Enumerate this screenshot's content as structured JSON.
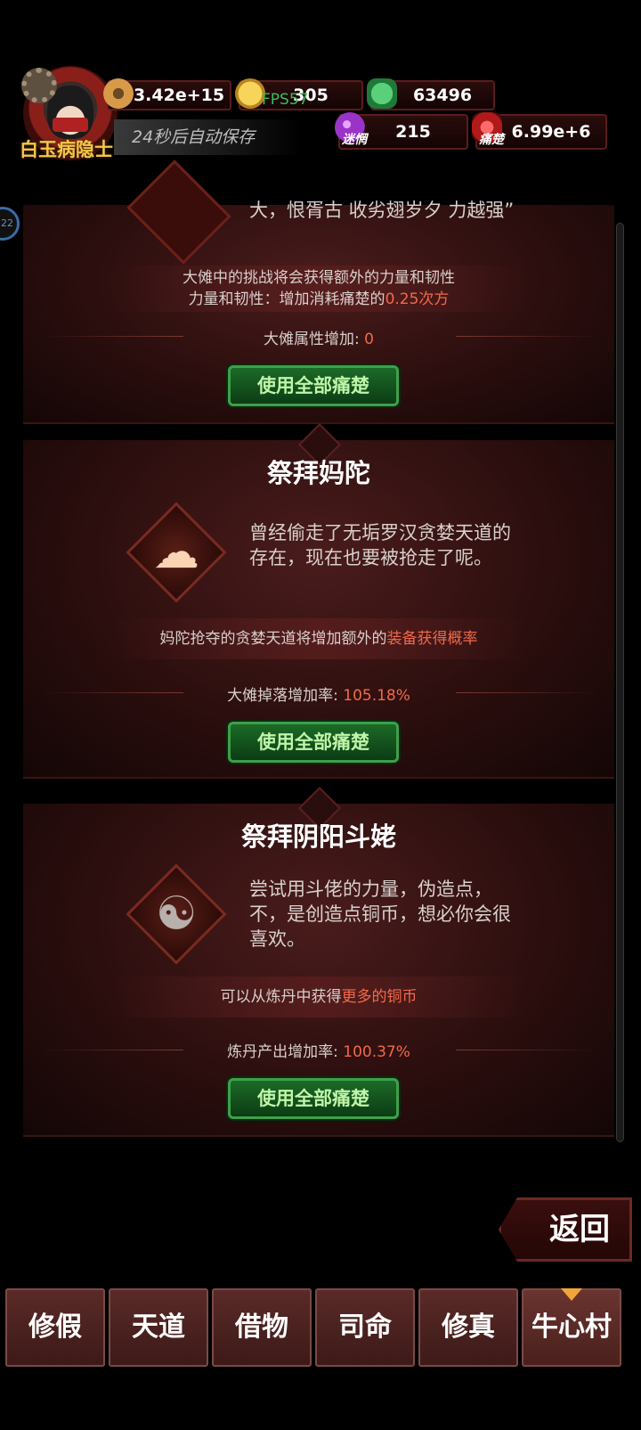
{
  "header": {
    "player_name": "白玉病隐士",
    "autosave_text": "24秒后自动保存",
    "fps": "FPS57",
    "resources": {
      "copper": "3.42e+15",
      "gold": "305",
      "jade": "63496",
      "confusion": "215",
      "confusion_label": "迷惘",
      "pain": "6.99e+6",
      "pain_label": "痛楚"
    },
    "side_badge": "22"
  },
  "cards": [
    {
      "desc": "大，恨胥古 收劣翅岁夕 力越强”",
      "effect": "大傩中的挑战将会获得额外的力量和韧性",
      "effect2_prefix": "力量和韧性：增加消耗痛楚的",
      "effect2_highlight": "0.25次方",
      "stat_label": "大傩属性增加: ",
      "stat_value": "0",
      "button": "使用全部痛楚"
    },
    {
      "title": "祭拜妈陀",
      "desc": "曾经偷走了无垢罗汉贪婪天道的存在，现在也要被抢走了呢。",
      "effect_prefix": "妈陀抢夺的贪婪天道将增加额外的",
      "effect_highlight": "装备获得概率",
      "stat_label": "大傩掉落增加率: ",
      "stat_value": "105.18%",
      "button": "使用全部痛楚"
    },
    {
      "title": "祭拜阴阳斗姥",
      "desc": "尝试用斗佬的力量，伪造点，不，是创造点铜币，想必你会很喜欢。",
      "effect_prefix": "可以从炼丹中获得",
      "effect_highlight": "更多的铜币",
      "stat_label": "炼丹产出增加率: ",
      "stat_value": "100.37%",
      "button": "使用全部痛楚"
    }
  ],
  "back_button": "返回",
  "tabs": [
    "修假",
    "天道",
    "借物",
    "司命",
    "修真",
    "牛心村"
  ],
  "active_tab": 5,
  "colors": {
    "highlight": "#f06a4a",
    "button_green": "#1c6a28",
    "name_gold": "#f2c74a"
  }
}
